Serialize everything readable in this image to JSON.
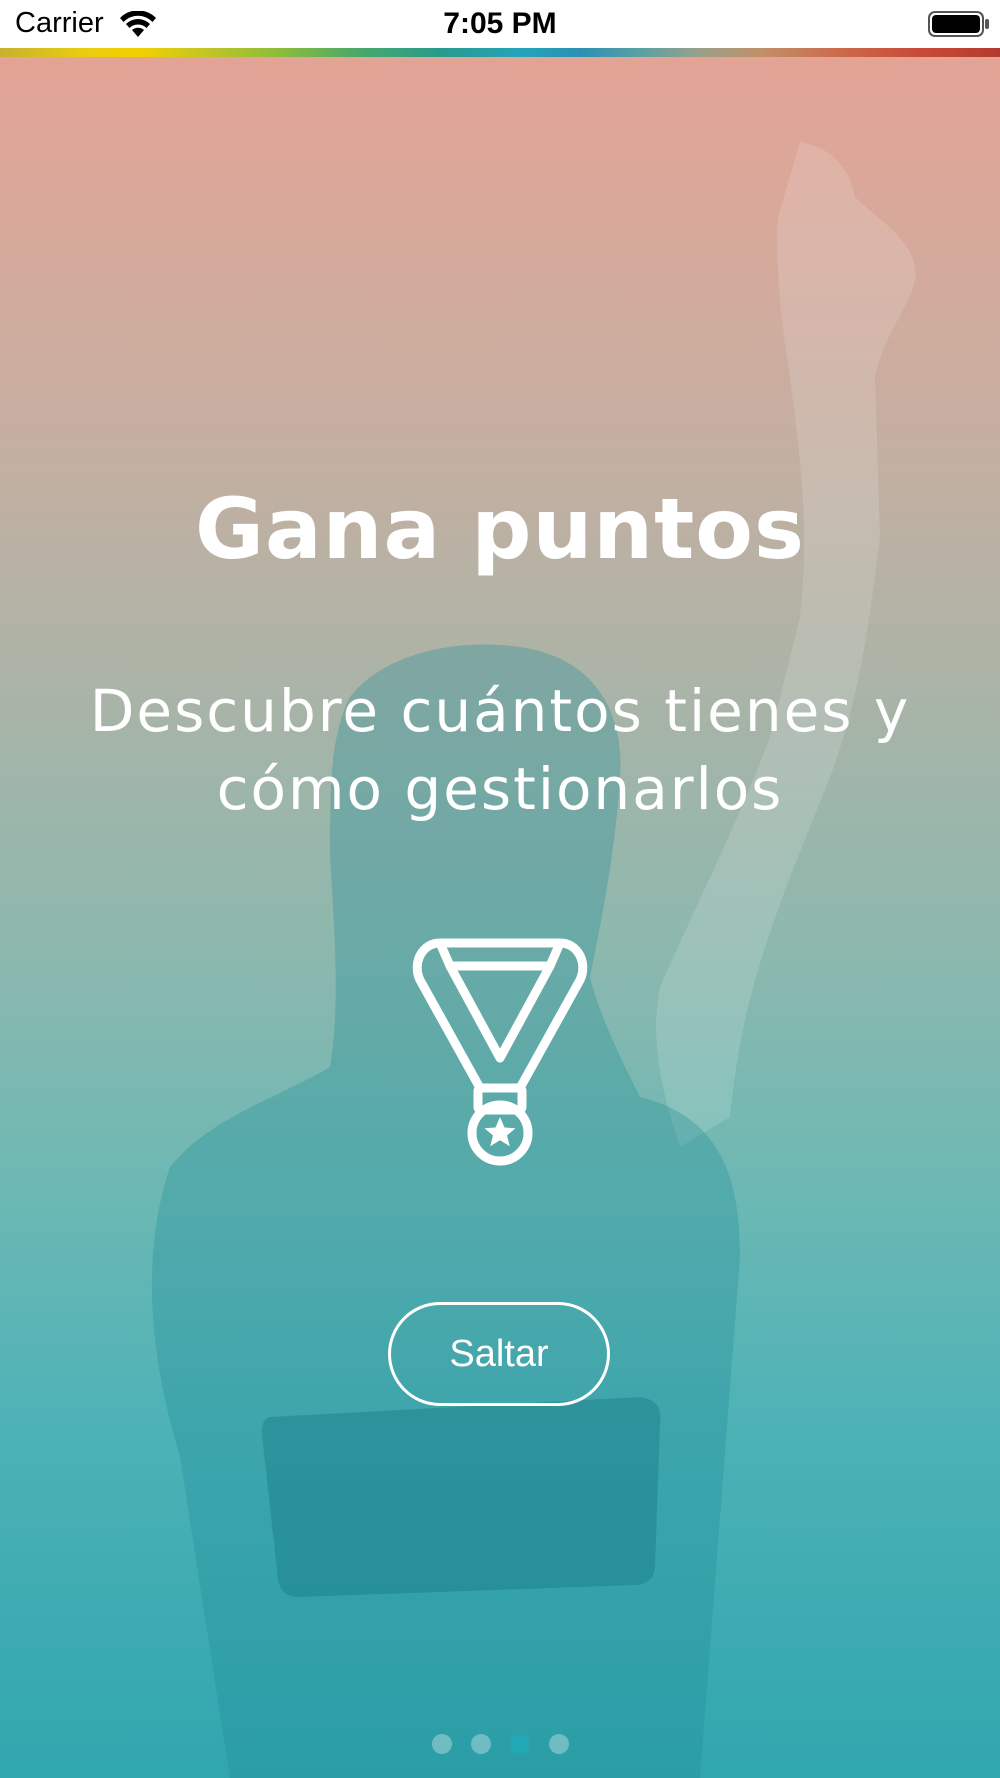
{
  "status_bar": {
    "carrier": "Carrier",
    "time": "7:05 PM",
    "icons": [
      "wifi-icon",
      "battery-icon"
    ]
  },
  "slide": {
    "title": "Gana puntos",
    "subtitle_line1": "Descubre cuántos tienes y",
    "subtitle_line2": "cómo gestionarlos",
    "icon": "medal-icon"
  },
  "skip_button": {
    "label": "Saltar"
  },
  "pager": {
    "count": 4,
    "active_index": 2
  },
  "colors": {
    "text": "#ffffff",
    "gradient_top": "#e3a395",
    "gradient_bottom": "#30a6ae",
    "active_dot": "#20a8b4"
  }
}
